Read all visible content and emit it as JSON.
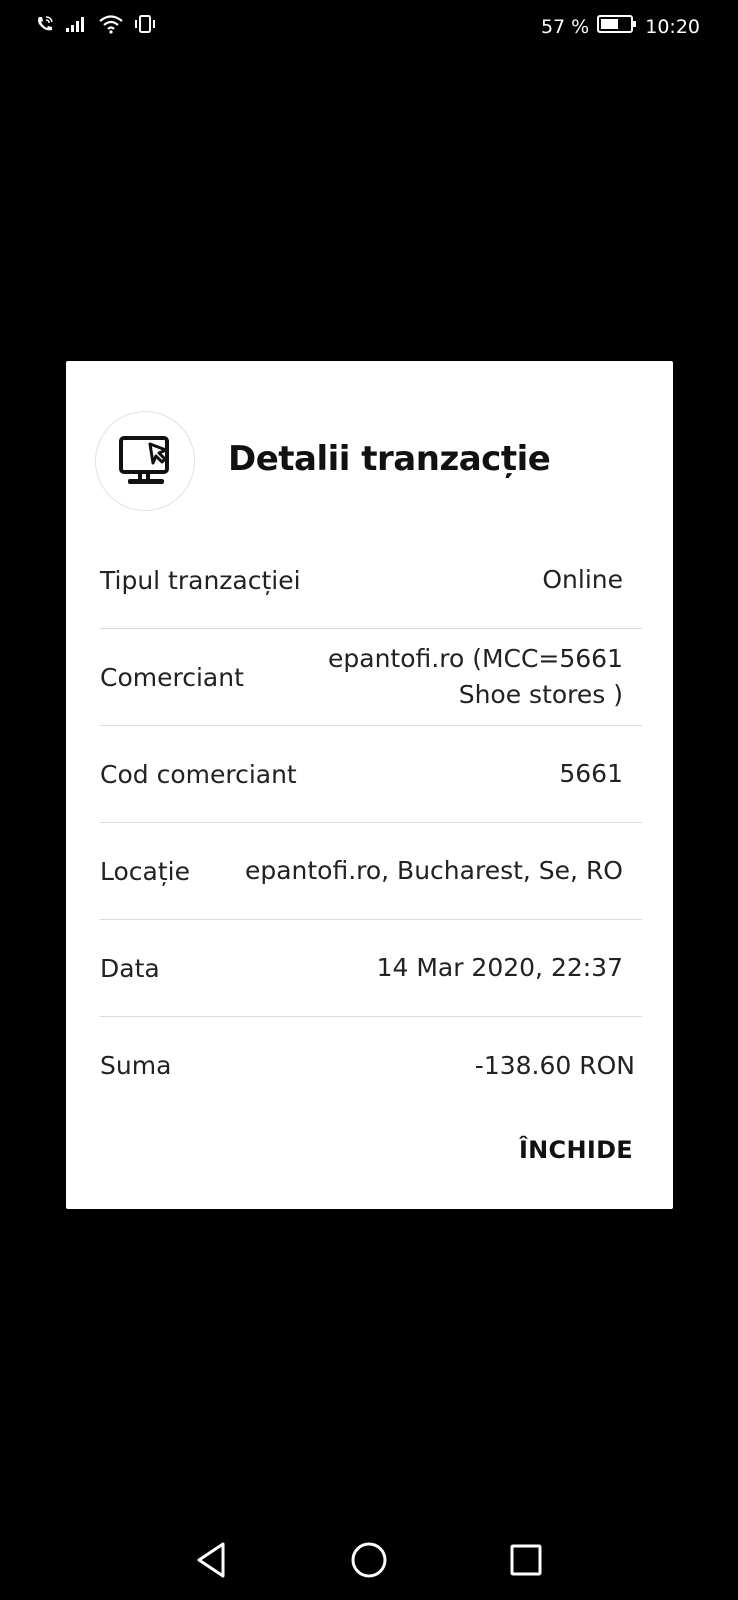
{
  "status_bar": {
    "battery_percent": "57 %",
    "time": "10:20",
    "icons": [
      "wifi-call-icon",
      "signal-icon",
      "wifi-icon",
      "vibrate-icon",
      "battery-icon"
    ]
  },
  "dialog": {
    "icon": "computer-cursor-icon",
    "title": "Detalii tranzacție",
    "rows": [
      {
        "label": "Tipul tranzacției",
        "value": "Online"
      },
      {
        "label": "Comerciant",
        "value": "epantofi.ro (MCC=5661 Shoe stores )"
      },
      {
        "label": "Cod comerciant",
        "value": "5661"
      },
      {
        "label": "Locație",
        "value": "epantofi.ro, Bucharest, Se, RO"
      },
      {
        "label": "Data",
        "value": "14 Mar 2020, 22:37"
      },
      {
        "label": "Suma",
        "value": "-138.60 RON"
      }
    ],
    "close_label": "ÎNCHIDE"
  },
  "nav_bar": {
    "icons": [
      "back-icon",
      "home-icon",
      "recents-icon"
    ]
  },
  "colors": {
    "background": "#000000",
    "dialog_bg": "#ffffff",
    "text": "#222222",
    "divider": "#dcdcdc"
  }
}
